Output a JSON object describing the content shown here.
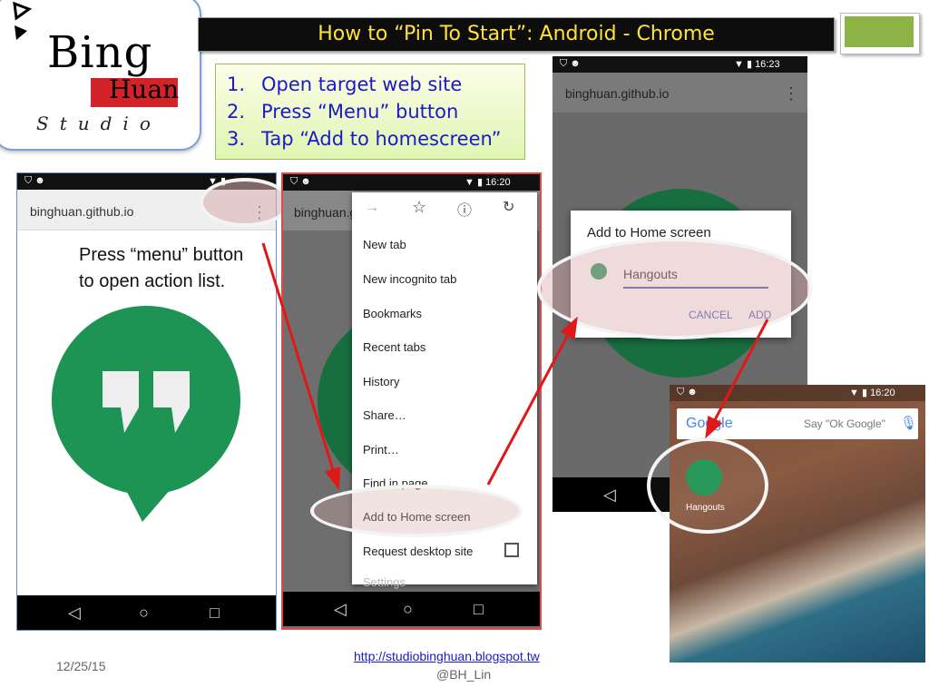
{
  "logo": {
    "line1": "Bing",
    "line2": "Huan",
    "line3": "Studio"
  },
  "title": "How to “Pin To Start”: Android - Chrome",
  "steps": [
    {
      "num": "1.",
      "text": "Open target web site"
    },
    {
      "num": "2.",
      "text": "Press “Menu” button"
    },
    {
      "num": "3.",
      "text": "Tap “Add to homescreen”"
    }
  ],
  "phone1": {
    "url": "binghuan.github.io",
    "caption_line1": "Press “menu” button",
    "caption_line2": "to open action list."
  },
  "phone2": {
    "time": "16:20",
    "url_partial": "binghuan.githu",
    "menu_items": [
      "New tab",
      "New incognito tab",
      "Bookmarks",
      "Recent tabs",
      "History",
      "Share…",
      "Print…",
      "Find in page",
      "Add to Home screen",
      "Request desktop site",
      "Settings"
    ]
  },
  "phone3": {
    "time": "16:23",
    "url": "binghuan.github.io",
    "dialog_title": "Add to Home screen",
    "app_name": "Hangouts",
    "cancel": "CANCEL",
    "add": "ADD"
  },
  "phone4": {
    "time": "16:20",
    "google": "Google",
    "search_hint": "Say \"Ok Google\"",
    "app_label": "Hangouts"
  },
  "footer": {
    "date": "12/25/15",
    "link": "http://studiobinghuan.blogspot.tw",
    "handle": "@BH_Lin"
  },
  "colors": {
    "title_text": "#ffe23a",
    "step_text": "#1a1ac8",
    "hangouts_green": "#1d9453",
    "arrow": "#e01818"
  }
}
